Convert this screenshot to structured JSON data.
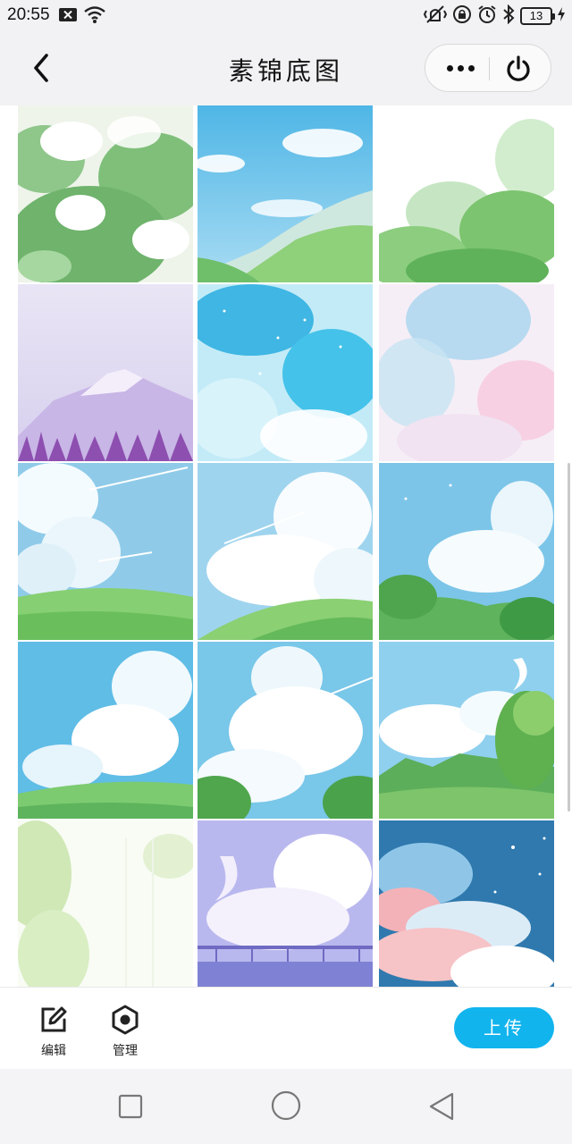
{
  "status_bar": {
    "time": "20:55",
    "battery": "13"
  },
  "header": {
    "title": "素锦底图",
    "back_icon": "chevron-left-icon",
    "more_icon": "more-dots-icon",
    "close_icon": "power-icon"
  },
  "gallery": {
    "images": [
      {
        "subject": "white flowering green foliage"
      },
      {
        "subject": "blue sky over green hills"
      },
      {
        "subject": "green foliage under white sky"
      },
      {
        "subject": "lavender mountain with purple pines"
      },
      {
        "subject": "blue starry watercolor sky"
      },
      {
        "subject": "pink and blue pastel clouds"
      },
      {
        "subject": "clouds over green meadow"
      },
      {
        "subject": "white clouds over green hill"
      },
      {
        "subject": "clouds over green trees"
      },
      {
        "subject": "cumulus clouds over field"
      },
      {
        "subject": "clouds over green bushes"
      },
      {
        "subject": "moon, clouds and green tree"
      },
      {
        "subject": "pale green leaves by window"
      },
      {
        "subject": "crescent moon, clouds, bridge"
      },
      {
        "subject": "pink clouds on starry night sky"
      }
    ]
  },
  "toolbar": {
    "edit_label": "编辑",
    "manage_label": "管理",
    "upload_label": "上传",
    "accent": "#12b4ee"
  }
}
